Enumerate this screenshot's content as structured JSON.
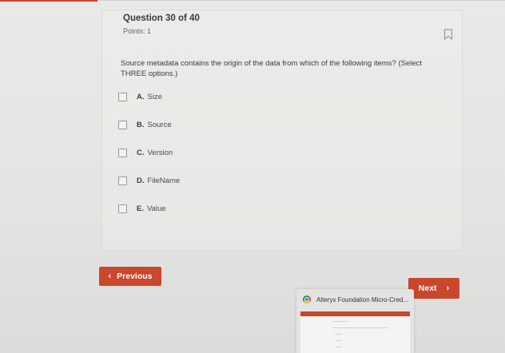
{
  "question": {
    "header": "Question 30 of 40",
    "points": "Points: 1",
    "text": "Source metadata contains the origin of the data from which of the following items? (Select THREE options.)",
    "options": [
      {
        "letter": "A.",
        "text": "Size"
      },
      {
        "letter": "B.",
        "text": "Source"
      },
      {
        "letter": "C.",
        "text": "Version"
      },
      {
        "letter": "D.",
        "text": "FileName"
      },
      {
        "letter": "E.",
        "text": "Value"
      }
    ]
  },
  "nav": {
    "previous_label": "Previous",
    "next_label": "Next"
  },
  "taskbar_preview": {
    "title": "Alteryx Foundation Micro-Cred..."
  },
  "colors": {
    "accent": "#c9472c",
    "background": "#e6e6e4"
  },
  "icons": {
    "bookmark": "bookmark-icon",
    "previous": "chevron-left-icon",
    "next": "chevron-right-icon",
    "browser": "chrome-icon"
  }
}
